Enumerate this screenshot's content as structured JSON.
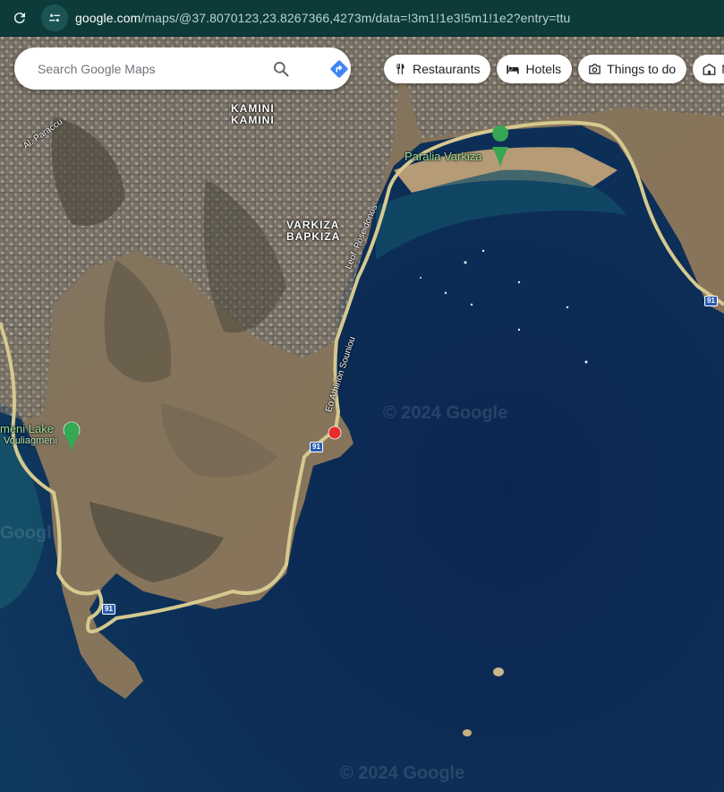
{
  "browser": {
    "url_host": "google.com",
    "url_rest": "/maps/@37.8070123,23.8267366,4273m/data=!3m1!1e3!5m1!1e2?entry=ttu"
  },
  "search": {
    "placeholder": "Search Google Maps"
  },
  "chips": [
    {
      "label": "Restaurants",
      "icon": "fork-knife-icon"
    },
    {
      "label": "Hotels",
      "icon": "bed-icon"
    },
    {
      "label": "Things to do",
      "icon": "camera-icon"
    },
    {
      "label": "M",
      "icon": "museum-icon"
    }
  ],
  "map": {
    "places": {
      "kamini_latin": "KAMINI",
      "kamini_greek": "ΚΑΜΙΝΙ",
      "varkiza_latin": "VARKIZA",
      "varkiza_greek": "ΒΑΡΚΙΖΑ",
      "paralia": "Paralia Varkiza",
      "lake": "meni Lake",
      "lake_sub": "Vouliagmeni"
    },
    "roads": {
      "paraccu": "Al. Paraccu",
      "poseidonos": "Leof. Poseidonos",
      "athinon": "Eo Athinon Souniou",
      "route_number": "91"
    },
    "watermark": "© 2024 Google",
    "watermark_left": "Googl"
  },
  "colors": {
    "accent": "#4285f4",
    "url_bg": "#0d3b3a",
    "sea": "#0c2b4a",
    "land": "#8b7a5e",
    "pin_red": "#ea2b2b",
    "poi_green": "#34a853"
  }
}
